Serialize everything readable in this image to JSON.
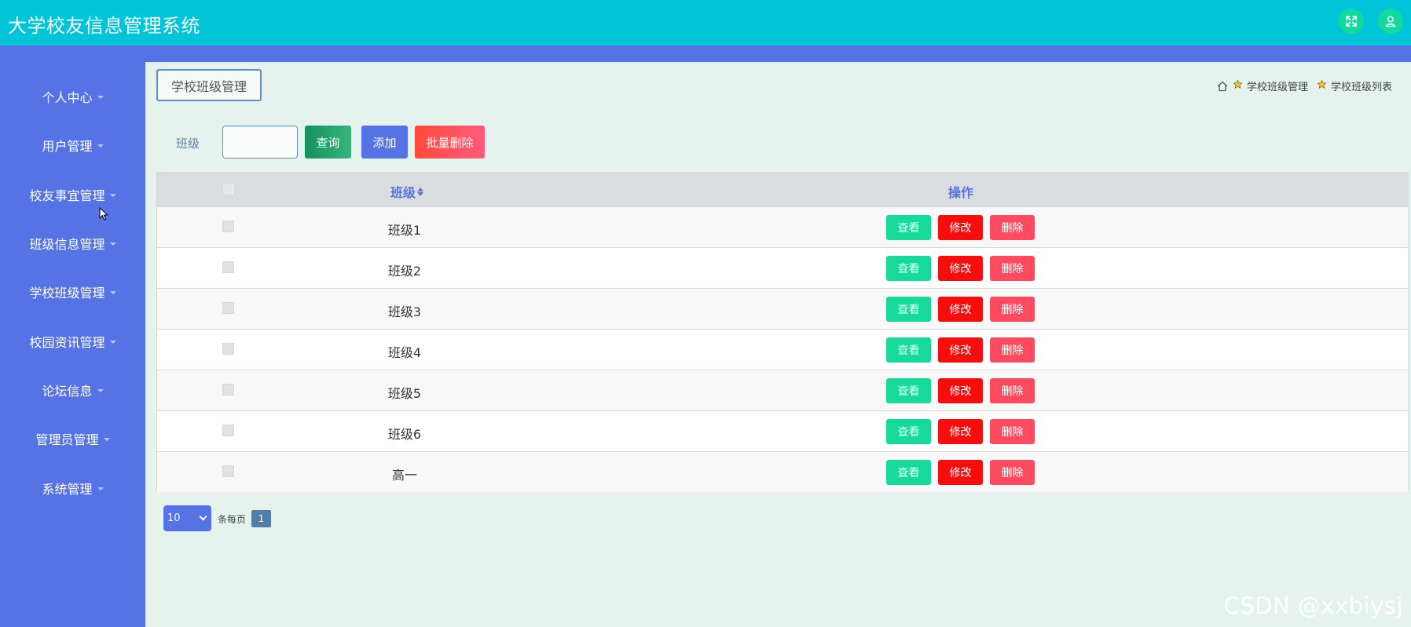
{
  "app": {
    "title": "大学校友信息管理系统"
  },
  "header": {
    "fullscreen_icon": "expand-icon",
    "user_icon": "user-icon"
  },
  "sidebar": {
    "items": [
      {
        "label": "个人中心"
      },
      {
        "label": "用户管理"
      },
      {
        "label": "校友事宜管理"
      },
      {
        "label": "班级信息管理"
      },
      {
        "label": "学校班级管理"
      },
      {
        "label": "校园资讯管理"
      },
      {
        "label": "论坛信息"
      },
      {
        "label": "管理员管理"
      },
      {
        "label": "系统管理"
      }
    ]
  },
  "page": {
    "title": "学校班级管理",
    "breadcrumb": [
      "学校班级管理",
      "学校班级列表"
    ]
  },
  "search": {
    "label": "班级",
    "value": "",
    "query_label": "查询",
    "add_label": "添加",
    "batch_delete_label": "批量删除"
  },
  "table": {
    "columns": {
      "class": "班级",
      "actions": "操作"
    },
    "rows": [
      {
        "class": "班级1"
      },
      {
        "class": "班级2"
      },
      {
        "class": "班级3"
      },
      {
        "class": "班级4"
      },
      {
        "class": "班级5"
      },
      {
        "class": "班级6"
      },
      {
        "class": "高一"
      }
    ],
    "actions": {
      "view": "查看",
      "edit": "修改",
      "delete": "删除"
    }
  },
  "pagination": {
    "page_size": "10",
    "per_page_label": "条每页",
    "current_page": "1"
  },
  "watermark": "CSDN @xxbiysj",
  "colors": {
    "header": "#00c4d8",
    "sidebar": "#5673e6",
    "view_button": "#16d99a",
    "edit_button": "#f80d0d",
    "delete_button": "#ff4a60"
  }
}
